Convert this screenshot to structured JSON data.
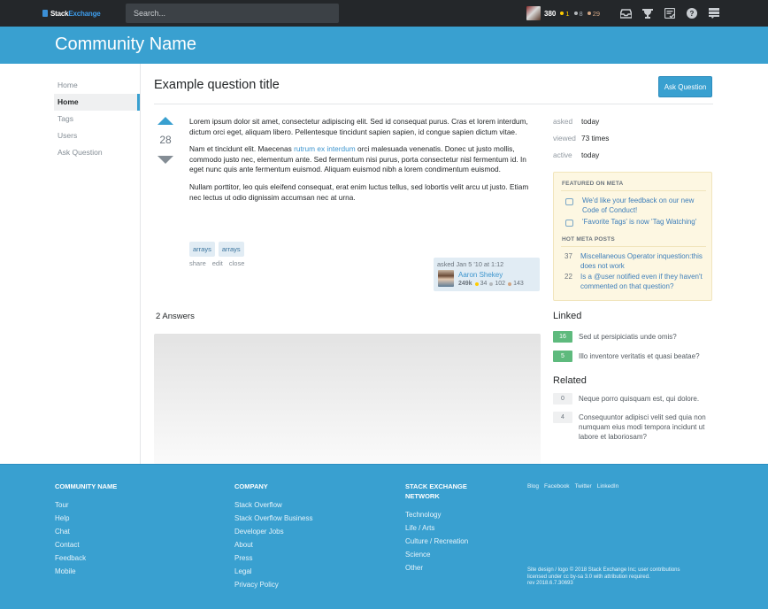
{
  "topbar": {
    "logo_part1": "Stack",
    "logo_part2": "Exchange",
    "search_placeholder": "Search...",
    "user": {
      "reputation": "380",
      "gold": "1",
      "silver": "8",
      "bronze": "29"
    },
    "icons": [
      "inbox-icon",
      "achievements-icon",
      "review-icon",
      "help-icon",
      "site-switcher-icon"
    ]
  },
  "header": {
    "title": "Community Name"
  },
  "sidebar": {
    "items": [
      {
        "label": "Home",
        "active": false
      },
      {
        "label": "Home",
        "active": true
      },
      {
        "label": "Tags",
        "active": false
      },
      {
        "label": "Users",
        "active": false
      },
      {
        "label": "Ask Question",
        "active": false
      }
    ]
  },
  "question": {
    "title": "Example question title",
    "ask_button": "Ask Question",
    "votes": "28",
    "paragraphs": {
      "p1": "Lorem ipsum dolor sit amet, consectetur adipiscing elit. Sed id consequat purus. Cras et lorem interdum, dictum orci eget, aliquam libero. Pellentesque tincidunt sapien sapien, id congue sapien dictum vitae.",
      "p2_before": "Nam et tincidunt elit. Maecenas ",
      "p2_link": "rutrum ex interdum",
      "p2_after": " orci malesuada venenatis. Donec ut justo mollis, commodo justo nec, elementum ante. Sed fermentum nisi purus, porta consectetur nisl fermentum id. In eget nunc quis ante fermentum euismod. Aliquam euismod nibh a lorem condimentum euismod.",
      "p3": "Nullam porttitor, leo quis eleifend consequat, erat enim luctus tellus, sed lobortis velit arcu ut justo. Etiam nec lectus ut odio dignissim accumsan nec at urna."
    },
    "tags": [
      "arrays",
      "arrays"
    ],
    "menu": [
      "share",
      "edit",
      "close"
    ],
    "owner": {
      "asked": "asked Jan 5 '10 at 1:12",
      "name": "Aaron Shekey",
      "reputation": "249k",
      "gold": "34",
      "silver": "102",
      "bronze": "143"
    },
    "answers_header": "2 Answers"
  },
  "meta": {
    "rows": [
      {
        "key": "asked",
        "value": "today"
      },
      {
        "key": "viewed",
        "value": "73 times"
      },
      {
        "key": "active",
        "value": "today"
      }
    ]
  },
  "featured": {
    "heading1": "FEATURED ON META",
    "items1": [
      "We'd like your feedback on our new Code of Conduct!",
      "'Favorite Tags' is now 'Tag Watching'"
    ],
    "heading2": "HOT META POSTS",
    "items2": [
      {
        "count": "37",
        "title": "Miscellaneous Operator inquestion:this does not work"
      },
      {
        "count": "22",
        "title": "Is a @user notified even if they haven't commented on that question?"
      }
    ]
  },
  "linked": {
    "title": "Linked",
    "items": [
      {
        "score": "16",
        "title": "Sed ut persipiciatis unde omis?"
      },
      {
        "score": "5",
        "title": "Illo inventore veritatis et quasi beatae?"
      }
    ]
  },
  "related": {
    "title": "Related",
    "items": [
      {
        "score": "0",
        "title": "Neque porro quisquam est, qui dolore."
      },
      {
        "score": "4",
        "title": "Consequuntor adipisci velit sed quia non numquam eius modi tempora incidunt ut labore et laboriosam?"
      }
    ]
  },
  "footer": {
    "col1": {
      "title": "COMMUNITY NAME",
      "links": [
        "Tour",
        "Help",
        "Chat",
        "Contact",
        "Feedback",
        "Mobile"
      ]
    },
    "col2": {
      "title": "COMPANY",
      "links": [
        "Stack Overflow",
        "Stack Overflow Business",
        "Developer Jobs",
        "About",
        "Press",
        "Legal",
        "Privacy Policy"
      ]
    },
    "col3": {
      "title": "STACK EXCHANGE NETWORK",
      "links": [
        "Technology",
        "Life / Arts",
        "Culture / Recreation",
        "Science",
        "Other"
      ]
    },
    "social": [
      "Blog",
      "Facebook",
      "Twitter",
      "LinkedIn"
    ],
    "copyright": {
      "line1": "Site design / logo © 2018 Stack Exchange Inc; user contributions",
      "line2": "licensed under cc by-sa 3.0 with attribution required.",
      "line3": "rev 2018.6.7.30693"
    }
  },
  "colors": {
    "brand": "#39a0d0",
    "topbar": "#24272a",
    "gold": "#ffcc01",
    "silver": "#b4b8bc",
    "bronze": "#d1a684",
    "accepted_green": "#5eba7d",
    "link": "#3d95ce"
  }
}
